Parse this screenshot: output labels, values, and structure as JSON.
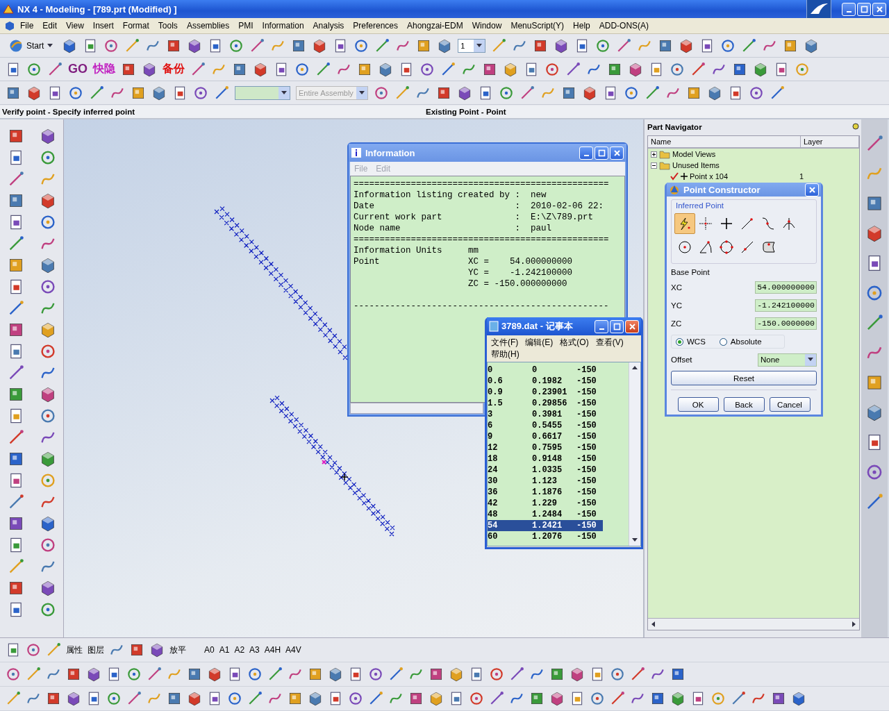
{
  "window": {
    "title": "NX 4 - Modeling - [789.prt (Modified) ]"
  },
  "menu": [
    "File",
    "Edit",
    "View",
    "Insert",
    "Format",
    "Tools",
    "Assemblies",
    "PMI",
    "Information",
    "Analysis",
    "Preferences",
    "Ahongzai-EDM",
    "Window",
    "MenuScript(Y)",
    "Help",
    "ADD-ONS(A)"
  ],
  "toolbar": {
    "start": "Start",
    "layer": "1",
    "assembly": "Entire Assembly",
    "labels": [
      "GO",
      "快隐",
      "备份"
    ]
  },
  "status": {
    "prompt": "Verify point - Specify inferred point",
    "selection": "Existing Point - Point"
  },
  "part_navigator": {
    "title": "Part Navigator",
    "columns": [
      "Name",
      "Layer"
    ],
    "tree": [
      {
        "label": "Model Views",
        "expanded": false
      },
      {
        "label": "Unused Items",
        "expanded": true,
        "children": [
          {
            "label": "Point x 104",
            "layer": "1",
            "checked": true
          }
        ]
      }
    ]
  },
  "information": {
    "title": "Information",
    "menu": [
      {
        "label": "File",
        "disabled": true
      },
      {
        "label": "Edit",
        "disabled": true
      }
    ],
    "lines": [
      "=================================================",
      "Information listing created by :  new",
      "Date                           :  2010-02-06 22:",
      "Current work part              :  E:\\Z\\789.prt",
      "Node name                      :  paul",
      "=================================================",
      "Information Units     mm",
      "Point                 XC =    54.000000000",
      "                      YC =    -1.242100000",
      "                      ZC = -150.000000000",
      "-------------------------------------------------"
    ]
  },
  "notepad": {
    "title": "3789.dat - 记事本",
    "menu": [
      "文件(F)",
      "编辑(E)",
      "格式(O)",
      "查看(V)",
      "帮助(H)"
    ],
    "rows": [
      {
        "cells": [
          "0",
          "0",
          "-150"
        ],
        "selected": false
      },
      {
        "cells": [
          "0.6",
          "0.1982",
          "-150"
        ],
        "selected": false
      },
      {
        "cells": [
          "0.9",
          "0.23901",
          "-150"
        ],
        "selected": false
      },
      {
        "cells": [
          "1.5",
          "0.29856",
          "-150"
        ],
        "selected": false
      },
      {
        "cells": [
          "3",
          "0.3981",
          "-150"
        ],
        "selected": false
      },
      {
        "cells": [
          "6",
          "0.5455",
          "-150"
        ],
        "selected": false
      },
      {
        "cells": [
          "9",
          "0.6617",
          "-150"
        ],
        "selected": false
      },
      {
        "cells": [
          "12",
          "0.7595",
          "-150"
        ],
        "selected": false
      },
      {
        "cells": [
          "18",
          "0.9148",
          "-150"
        ],
        "selected": false
      },
      {
        "cells": [
          "24",
          "1.0335",
          "-150"
        ],
        "selected": false
      },
      {
        "cells": [
          "30",
          "1.123",
          "-150"
        ],
        "selected": false
      },
      {
        "cells": [
          "36",
          "1.1876",
          "-150"
        ],
        "selected": false
      },
      {
        "cells": [
          "42",
          "1.229",
          "-150"
        ],
        "selected": false
      },
      {
        "cells": [
          "48",
          "1.2484",
          "-150"
        ],
        "selected": false
      },
      {
        "cells": [
          "54",
          "1.2421",
          "-150"
        ],
        "selected": true
      },
      {
        "cells": [
          "60",
          "1.2076",
          "-150"
        ],
        "selected": false
      }
    ]
  },
  "point_constructor": {
    "title": "Point Constructor",
    "group": "Inferred Point",
    "point_types": [
      {
        "kind": "inferred",
        "selected": true
      },
      {
        "kind": "cursor",
        "selected": false
      },
      {
        "kind": "existing",
        "selected": false
      },
      {
        "kind": "end",
        "selected": false
      },
      {
        "kind": "control",
        "selected": false
      },
      {
        "kind": "intersection",
        "selected": false
      },
      {
        "kind": "center",
        "selected": false
      },
      {
        "kind": "angle",
        "selected": false
      },
      {
        "kind": "quadrant",
        "selected": false
      },
      {
        "kind": "on-curve",
        "selected": false
      },
      {
        "kind": "on-face",
        "selected": false
      }
    ],
    "base_point": "Base Point",
    "fields": [
      {
        "label": "XC",
        "value": "54.000000000"
      },
      {
        "label": "YC",
        "value": "-1.242100000"
      },
      {
        "label": "ZC",
        "value": "-150.0000000"
      }
    ],
    "coords": [
      {
        "label": "WCS",
        "selected": true
      },
      {
        "label": "Absolute",
        "selected": false
      }
    ],
    "offset": {
      "label": "Offset",
      "value": "None"
    },
    "reset": "Reset",
    "buttons": [
      "OK",
      "Back",
      "Cancel"
    ]
  },
  "bottom_toolbar": {
    "labels": [
      "属性",
      "图层",
      "放平"
    ],
    "sizes": [
      "A0",
      "A1",
      "A2",
      "A3",
      "A4H",
      "A4V"
    ]
  }
}
